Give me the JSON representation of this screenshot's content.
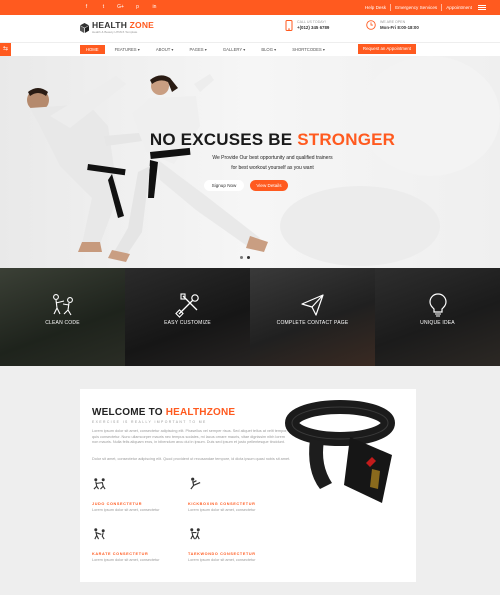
{
  "social": [
    "f",
    "t",
    "G+",
    "p",
    "in"
  ],
  "topbar": {
    "links": [
      "Help Desk",
      "Emergency Services",
      "Appointment"
    ]
  },
  "header": {
    "logo_main": "HEALTH",
    "logo_accent": "ZONE",
    "logo_tagline": "Health & Beauty HTML5 Template",
    "call_label": "CALL US TODAY!",
    "call_value": "+(012) 345 6789",
    "open_label": "WE ARE OPEN",
    "open_value": "Mon-Fri 8:00-18:00"
  },
  "nav": {
    "items": [
      "HOME",
      "FEATURES",
      "ABOUT",
      "PAGES",
      "GALLERY",
      "BLOG",
      "SHORTCODES"
    ],
    "appointment": "Request an Appointment"
  },
  "hero": {
    "title_dark": "NO EXCUSES BE",
    "title_accent": "STRONGER",
    "sub_line1": "We Provide Our best opportunity and qualified trainers",
    "sub_line2": "for best workout yourself as you want",
    "btn_signup": "Signup Now",
    "btn_details": "View Details"
  },
  "features": [
    "CLEAN CODE",
    "EASY CUSTOMIZE",
    "COMPLETE CONTACT PAGE",
    "UNIQUE IDEA"
  ],
  "welcome": {
    "title_dark": "WELCOME TO",
    "title_accent": "HEALTHZONE",
    "subtitle": "EXERCISE IS REALLY IMPORTANT TO ME",
    "para1": "Lorem ipsum dolor sit amet, consectetur adipiscing elit. Phasellus vel semper risus. Sed aliquet tellus at velit tempor, quis consectetur. Nunc ullamcorper mauris nec tempus sodales, mi lacus ornare mauris, vitae dignissim nibh lorem non mauris. Nulla felis aliquam eros, in bibendum arcu dui in ipsum. Duis sed ipsum et justo pellentesque tincidunt.",
    "para2": "Dolor sit amet, consectetur adipiscing elit. Quod provident ut recusandae tempore, id dicta ipsum quasi nobis sit amet.",
    "services": [
      {
        "title": "JUDO CONSECTETUR",
        "desc": "Lorem ipsum dolor sit amet, consectetur"
      },
      {
        "title": "KICKBOXING CONSECTETUR",
        "desc": "Lorem ipsum dolor sit amet, consectetur"
      },
      {
        "title": "KARATE CONSECTETUR",
        "desc": "Lorem ipsum dolor sit amet, consectetur"
      },
      {
        "title": "TAEKWONDO CONSECTETUR",
        "desc": "Lorem ipsum dolor sit amet, consectetur"
      }
    ]
  },
  "colors": {
    "accent": "#ff5a1f",
    "dark": "#1a1a1a"
  }
}
